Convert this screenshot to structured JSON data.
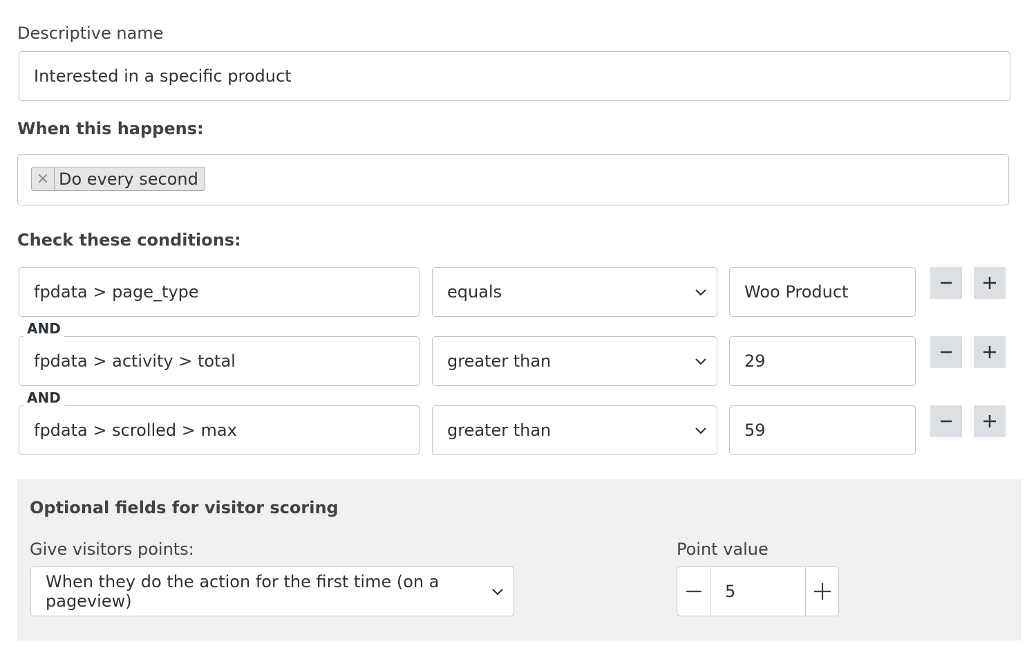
{
  "descriptive_name": {
    "label": "Descriptive name",
    "value": "Interested in a specific product"
  },
  "trigger": {
    "heading": "When this happens:",
    "tag_remove": "×",
    "tag_label": "Do every second"
  },
  "conditions": {
    "heading": "Check these conditions:",
    "connector": "AND",
    "rows": [
      {
        "field": "fpdata > page_type",
        "operator": "equals",
        "value": "Woo Product"
      },
      {
        "field": "fpdata > activity > total",
        "operator": "greater than",
        "value": "29"
      },
      {
        "field": "fpdata > scrolled > max",
        "operator": "greater than",
        "value": "59"
      }
    ],
    "remove_icon": "minus-icon",
    "add_icon": "plus-icon"
  },
  "scoring": {
    "heading": "Optional fields for visitor scoring",
    "points_label": "Give visitors points:",
    "points_option": "When they do the action for the first time (on a pageview)",
    "point_value_label": "Point value",
    "point_value": "5"
  },
  "colors": {
    "button_bg": "#dcdfe3",
    "panel_bg": "#f0f0f1",
    "border": "#c3c4c7",
    "text": "#3c434a"
  }
}
